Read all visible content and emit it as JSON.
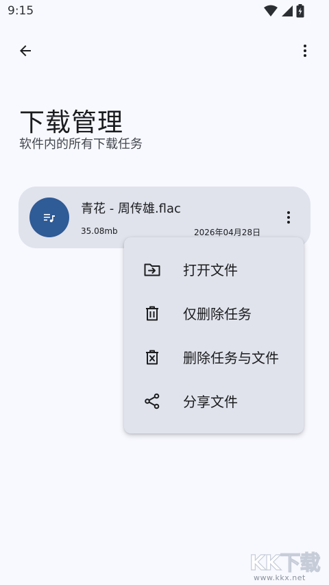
{
  "status_bar": {
    "time": "9:15"
  },
  "header": {
    "title": "下载管理",
    "subtitle": "软件内的所有下载任务"
  },
  "task": {
    "file_name": "青花 - 周传雄.flac",
    "size": "35.08mb",
    "date": "2026年04月28日",
    "avatar_icon": "music-note-icon",
    "avatar_color": "#2f5b96"
  },
  "menu": {
    "items": [
      {
        "label": "打开文件",
        "icon": "folder-open-icon"
      },
      {
        "label": "仅删除任务",
        "icon": "trash-icon"
      },
      {
        "label": "删除任务与文件",
        "icon": "delete-file-icon"
      },
      {
        "label": "分享文件",
        "icon": "share-icon"
      }
    ]
  },
  "watermark": {
    "logo": "KK下载",
    "url": "www.kkx.net"
  },
  "colors": {
    "background": "#f8f9ff",
    "card": "#e0e2ec",
    "accent": "#2f5b96"
  }
}
